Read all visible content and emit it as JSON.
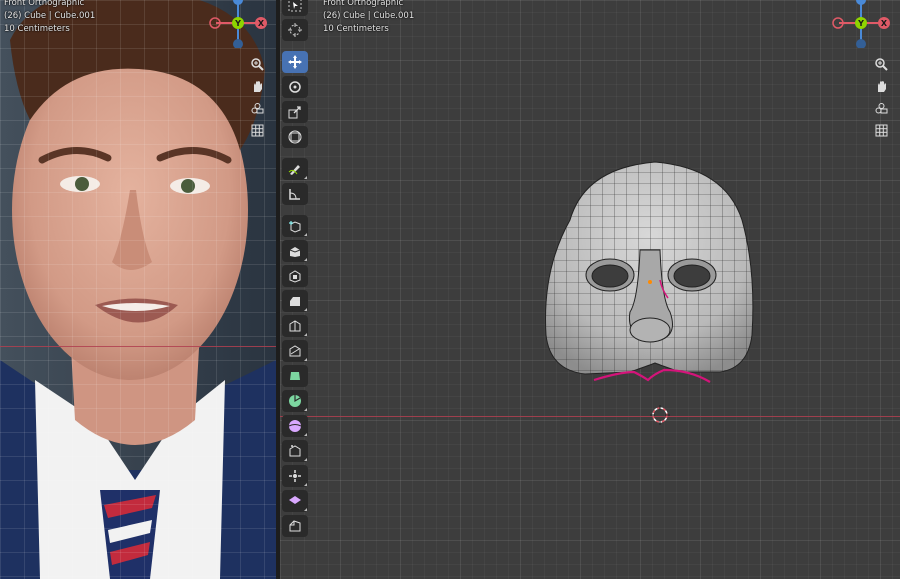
{
  "left_viewport": {
    "view_name": "Front Orthographic",
    "object_info": "(26) Cube | Cube.001",
    "scale_info": "10 Centimeters",
    "reference_image": "portrait-photo"
  },
  "right_viewport": {
    "view_name": "Front Orthographic",
    "object_info": "(26) Cube | Cube.001",
    "scale_info": "10 Centimeters",
    "model": "face-mask-mesh"
  },
  "gizmo": {
    "z_label": "Z",
    "y_label": "Y",
    "x_label": "X"
  },
  "nav_tools": [
    "zoom-icon",
    "hand-pan-icon",
    "camera-icon",
    "grid-icon"
  ],
  "toolbar": [
    "select-box-icon",
    "cursor-icon",
    "move-icon",
    "rotate-icon",
    "scale-icon",
    "transform-icon",
    "annotate-icon",
    "measure-icon",
    "add-cube-icon",
    "extrude-icon",
    "inset-icon",
    "bevel-icon",
    "loop-cut-icon",
    "knife-icon",
    "poly-build-icon",
    "spin-icon",
    "smooth-icon",
    "edge-slide-icon",
    "shrink-fatten-icon",
    "shear-icon",
    "rip-icon"
  ],
  "colors": {
    "active_tool": "#4772b3",
    "axis_x": "#e05a67",
    "axis_y": "#8ed400",
    "axis_z": "#4a8ad8",
    "seam": "#d4147a",
    "viewport_bg": "#3d3d3d"
  }
}
